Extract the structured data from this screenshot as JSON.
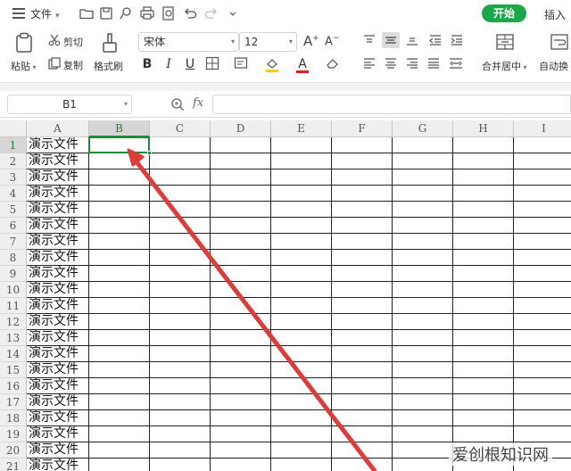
{
  "menubar": {
    "file_label": "文件",
    "start_tab": "开始",
    "insert_tab": "插入",
    "accent": "#1aa84b"
  },
  "ribbon": {
    "paste_label": "粘贴",
    "cut_label": "剪切",
    "copy_label": "复制",
    "format_painter_label": "格式刷",
    "font_name": "宋体",
    "font_size": "12",
    "merge_center_label": "合并居中",
    "wrap_label": "自动换",
    "font_color": "#e02020",
    "fill_color": "#f5d000"
  },
  "formula_bar": {
    "name_box": "B1",
    "fx_label": "fx",
    "formula": ""
  },
  "sheet": {
    "columns": [
      "A",
      "B",
      "C",
      "D",
      "E",
      "F",
      "G",
      "H",
      "I"
    ],
    "rows": [
      "1",
      "2",
      "3",
      "4",
      "5",
      "6",
      "7",
      "8",
      "9",
      "10",
      "11",
      "12",
      "13",
      "14",
      "15",
      "16",
      "17",
      "18",
      "19",
      "20",
      "21"
    ],
    "column_a_values": [
      "演示文件",
      "演示文件",
      "演示文件",
      "演示文件",
      "演示文件",
      "演示文件",
      "演示文件",
      "演示文件",
      "演示文件",
      "演示文件",
      "演示文件",
      "演示文件",
      "演示文件",
      "演示文件",
      "演示文件",
      "演示文件",
      "演示文件",
      "演示文件",
      "演示文件",
      "演示文件",
      "演示文件"
    ],
    "selected_cell": "B1",
    "selection_color": "#1e8a3a"
  },
  "annotation": {
    "arrow_color": "#e03a3a"
  },
  "watermark": "爱创根知识网"
}
